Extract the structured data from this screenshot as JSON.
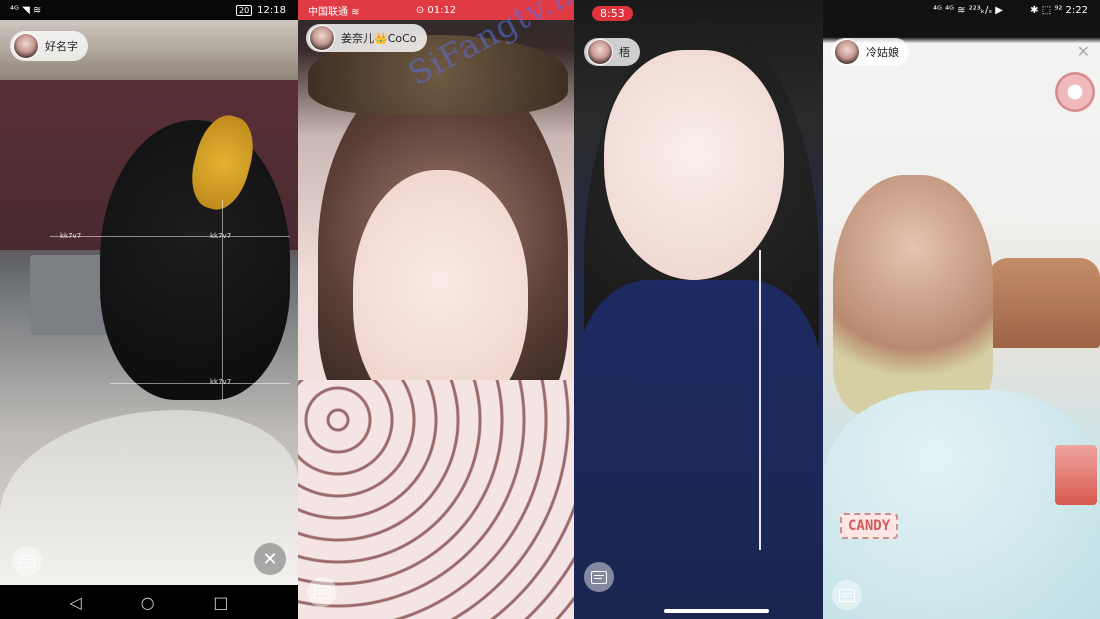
{
  "panels": [
    {
      "status": {
        "left": "⁴ᴳ ◥ ≋",
        "battery": "20",
        "time": "12:18"
      },
      "username": "好名字",
      "watermark_text": "kk7v7",
      "nav": {
        "back": "◁",
        "home": "○",
        "recent": "□"
      }
    },
    {
      "status": {
        "carrier": "中国联通 ≋",
        "center": "⊙ 01:12"
      },
      "username": "姜奈儿👑CoCo"
    },
    {
      "status": {
        "time": "8:53"
      },
      "username": "梧"
    },
    {
      "status": {
        "left": "⁴ᴳ ⁴ᴳ ≋ ²²³ₖ/ₛ ▶",
        "right": "✱ ⬚ ⁹² 2:22"
      },
      "username": "冷姑娘",
      "sticker": "CANDY"
    }
  ],
  "site_watermark": "SiFangtv.net",
  "colors": {
    "status_red": "#e03b45",
    "time_pill": "#e0323d",
    "candy_text": "#d15b5b"
  }
}
